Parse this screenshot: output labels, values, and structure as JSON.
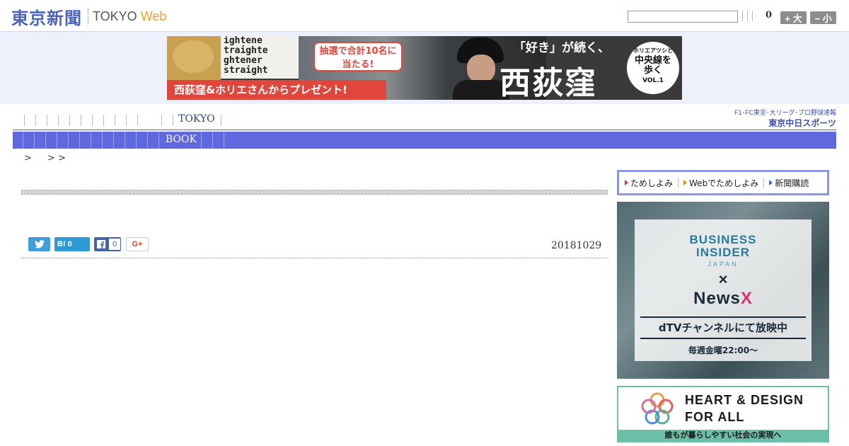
{
  "header": {
    "logo_kanji": "東京新聞",
    "logo_tokyo": "TOKYO",
    "logo_web": "Web",
    "search_placeholder": "",
    "font_size_count": "0",
    "larger_label": "+ 大",
    "smaller_label": "− 小"
  },
  "top_banner": {
    "stamp_lines": [
      "ightene",
      "traighte",
      "ghtener",
      "straight"
    ],
    "bubble_line1": "抽選で合計10名に",
    "bubble_line2": "当たる!",
    "red_strip": "西荻窪&ホリエさんからプレゼント!",
    "quote": "「好き」が続く、",
    "title": "西荻窪",
    "circle_line1": "ホリエアツシと",
    "circle_line2": "中央線を",
    "circle_line3": "歩く",
    "circle_line4": "VOL.1"
  },
  "nav": {
    "tokyo_label": "TOKYO",
    "book_label": "BOOK",
    "chunichi_small": "F1･FC東京･大リーグ･プロ野球速報",
    "chunichi_big": "東京中日スポーツ"
  },
  "breadcrumb": [
    ">",
    "> >"
  ],
  "article": {
    "date": "20181029",
    "hatena_count": "0",
    "facebook_count": "0"
  },
  "sidebar": {
    "links": [
      "ためしよみ",
      "Webでためしよみ",
      "新聞購読"
    ],
    "bi_line1": "BUSINESS",
    "bi_line2": "INSIDER",
    "bi_japan": "JAPAN",
    "bi_x": "×",
    "bi_news": "News",
    "bi_newsx": "X",
    "bi_bar": "dTVチャンネルにて放映中",
    "bi_sched": "毎週金曜22:00〜",
    "heart_line1": "HEART & DESIGN",
    "heart_line2": "FOR ALL",
    "heart_strip": "誰もが暮らしやすい社会の実現へ"
  }
}
